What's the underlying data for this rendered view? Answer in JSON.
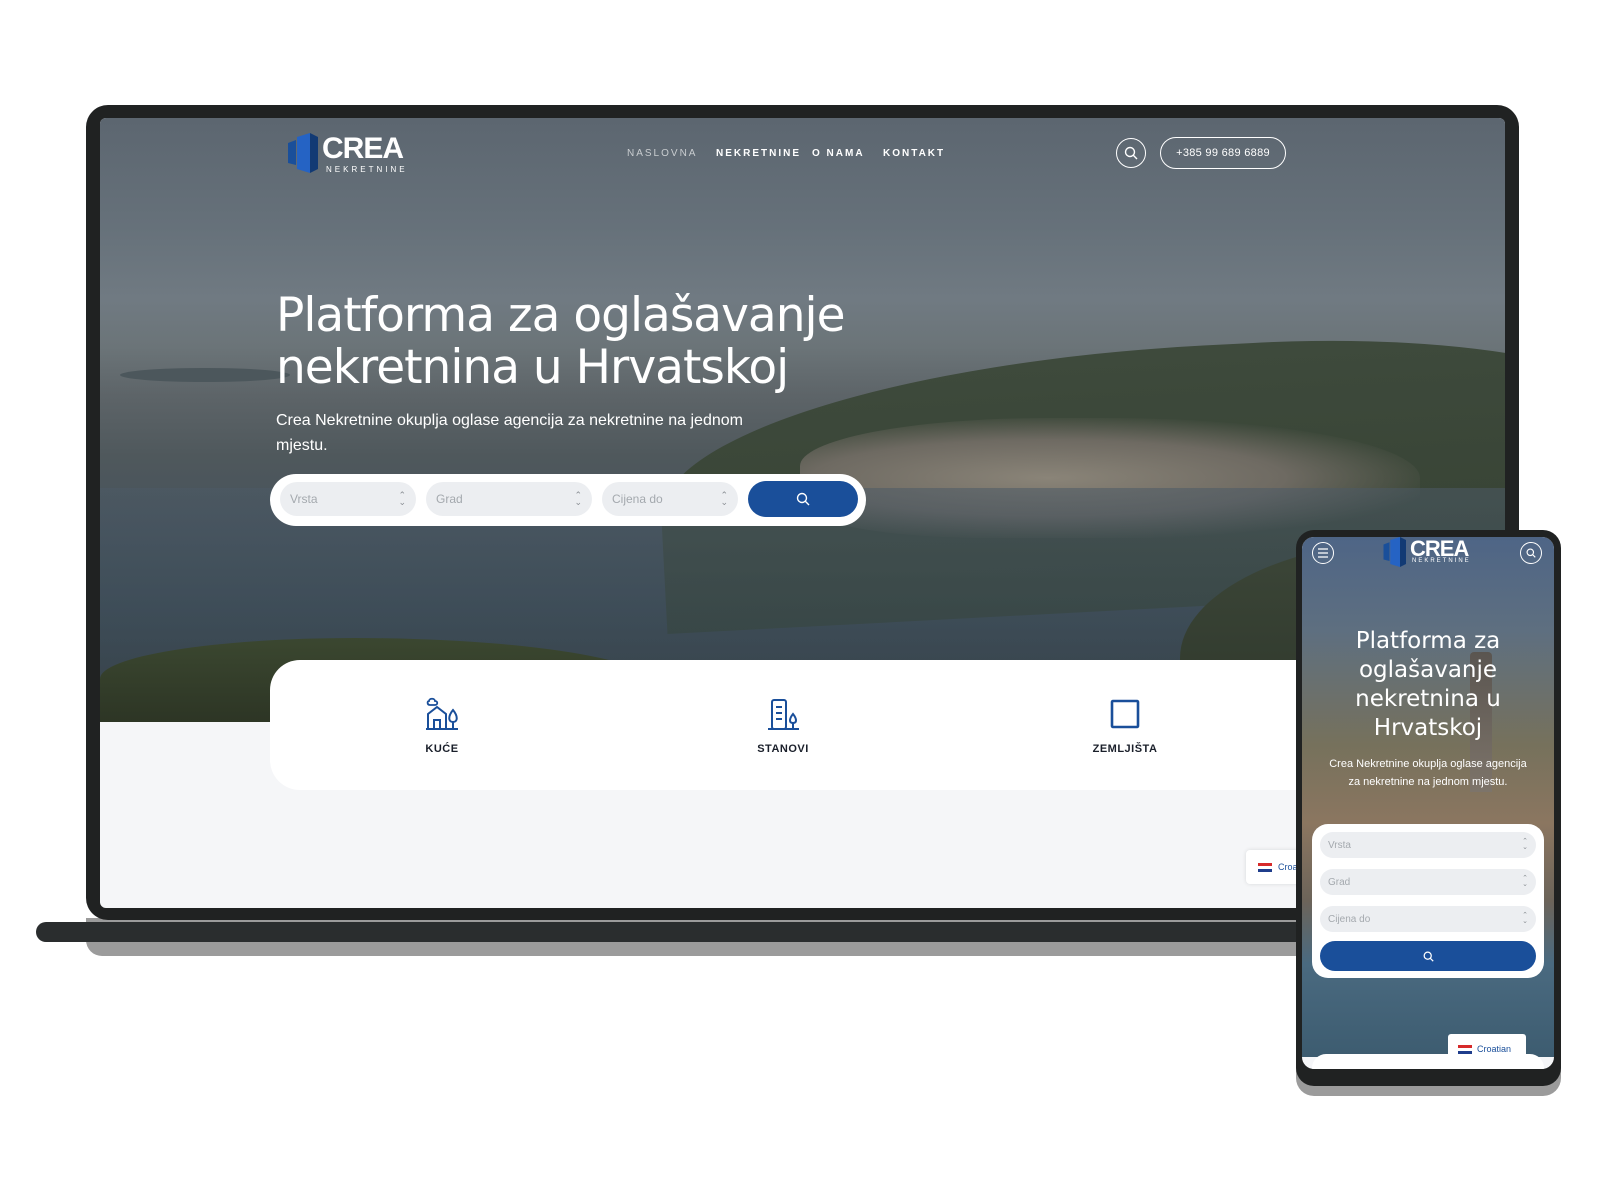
{
  "brand": {
    "name": "CREA",
    "tagline": "NEKRETNINE",
    "accent": "#1a4f9a"
  },
  "nav": {
    "items": [
      {
        "label": "NASLOVNA",
        "active": true
      },
      {
        "label": "NEKRETNINE"
      },
      {
        "label": "O NAMA"
      },
      {
        "label": "KONTAKT"
      }
    ]
  },
  "header": {
    "phone": "+385 99 689 6889",
    "search_icon": "search-icon"
  },
  "hero": {
    "title": "Platforma za oglašavanje nekretnina u Hrvatskoj",
    "subtitle": "Crea Nekretnine okuplja oglase agencija za nekretnine na jednom mjestu."
  },
  "search": {
    "fields": [
      {
        "placeholder": "Vrsta"
      },
      {
        "placeholder": "Grad"
      },
      {
        "placeholder": "Cijena do"
      }
    ],
    "button_icon": "search-icon"
  },
  "categories": [
    {
      "label": "KUĆE",
      "icon": "house-icon"
    },
    {
      "label": "STANOVI",
      "icon": "apartment-building-icon"
    },
    {
      "label": "ZEMLJIŠTA",
      "icon": "land-square-icon"
    }
  ],
  "language": {
    "desktop_label": "Croa",
    "mobile_label": "Croatian"
  },
  "mobile": {
    "menu_icon": "hamburger-icon",
    "title": "Platforma za oglašavanje nekretnina u Hrvatskoj",
    "subtitle": "Crea Nekretnine okuplja oglase agencija za nekretnine na jednom mjestu."
  }
}
